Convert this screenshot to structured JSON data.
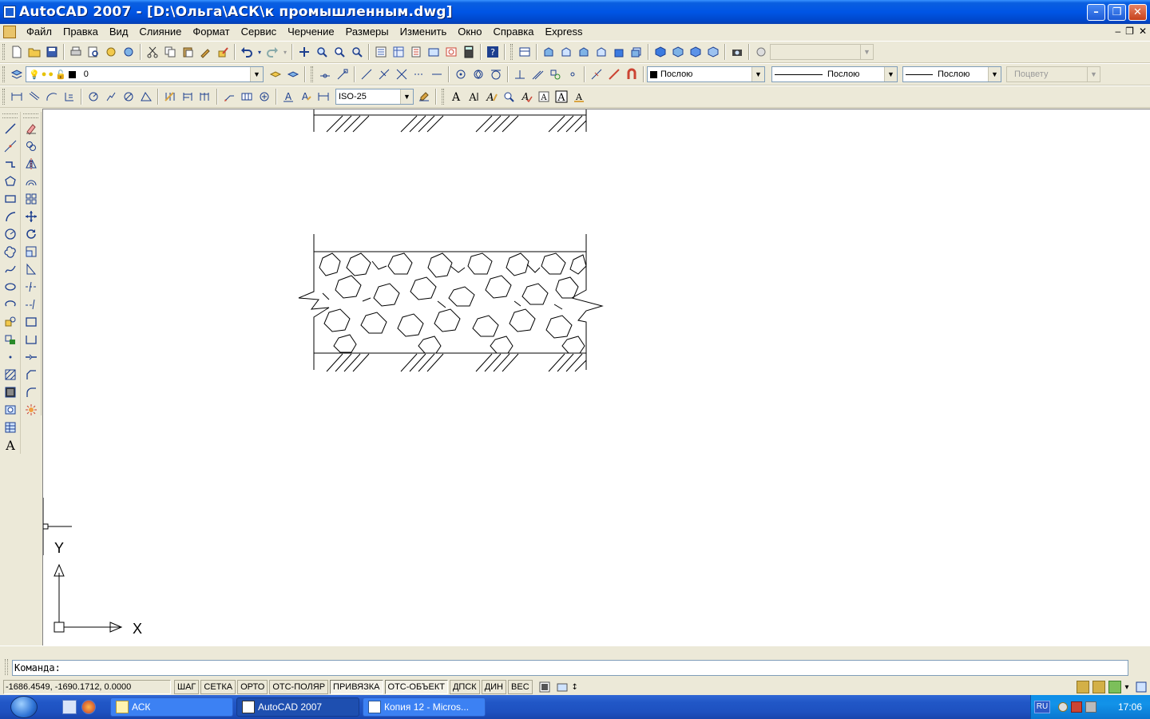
{
  "window": {
    "title": "AutoCAD 2007 - [D:\\Ольга\\АСК\\к промышленным.dwg]",
    "minimize": "–",
    "maximize": "❐",
    "close": "✕"
  },
  "menu": {
    "items": [
      "Файл",
      "Правка",
      "Вид",
      "Слияние",
      "Формат",
      "Сервис",
      "Черчение",
      "Размеры",
      "Изменить",
      "Окно",
      "Справка",
      "Express"
    ],
    "mdi_buttons": [
      "–",
      "❐",
      "✕"
    ]
  },
  "layers": {
    "current": "0"
  },
  "properties": {
    "color": "Послою",
    "linetype": "Послою",
    "lineweight": "Послою",
    "plotstyle": "Поцвету"
  },
  "styles": {
    "dimstyle": "ISO-25"
  },
  "command": {
    "prompt": "Команда:"
  },
  "status": {
    "coords": "-1686.4549, -1690.1712, 0.0000",
    "toggles": [
      {
        "label": "ШАГ",
        "on": false
      },
      {
        "label": "СЕТКА",
        "on": false
      },
      {
        "label": "ОРТО",
        "on": false
      },
      {
        "label": "ОТС-ПОЛЯР",
        "on": false
      },
      {
        "label": "ПРИВЯЗКА",
        "on": true
      },
      {
        "label": "ОТС-ОБЪЕКТ",
        "on": true
      },
      {
        "label": "ДПСК",
        "on": false
      },
      {
        "label": "ДИН",
        "on": false
      },
      {
        "label": "ВЕС",
        "on": false
      }
    ]
  },
  "ucs": {
    "x_label": "X",
    "y_label": "Y"
  },
  "taskbar": {
    "tasks": [
      {
        "label": "АСК",
        "active": false
      },
      {
        "label": "AutoCAD 2007",
        "active": true
      },
      {
        "label": "Копия 12 - Micros...",
        "active": false
      }
    ],
    "lang": "RU",
    "clock": "17:06"
  }
}
